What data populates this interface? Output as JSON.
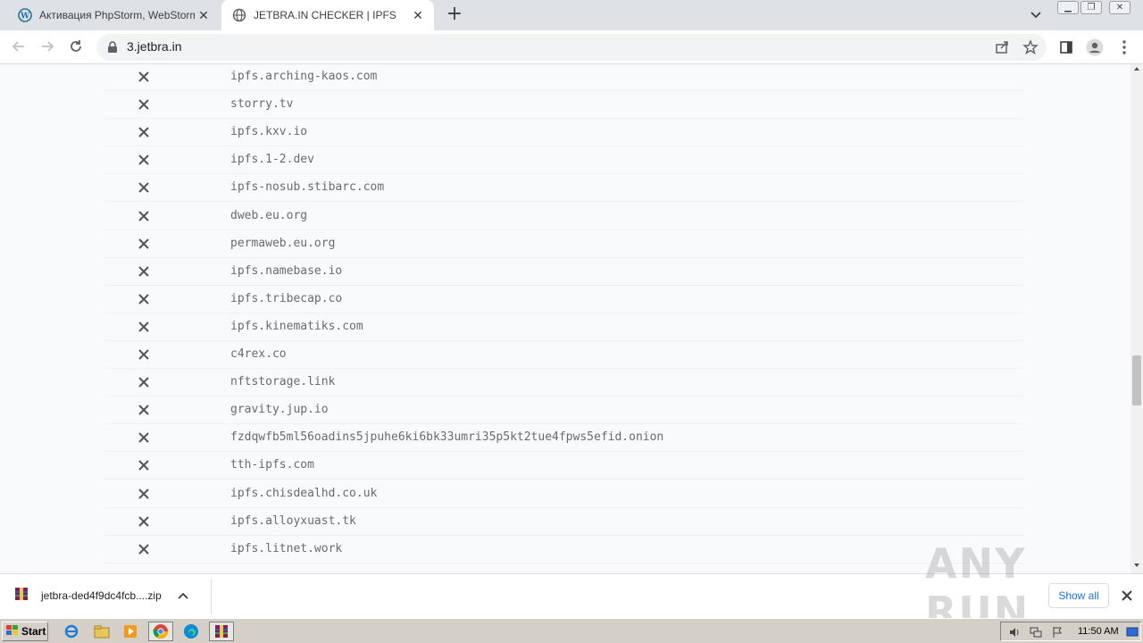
{
  "tabs": [
    {
      "title": "Активация PhpStorm, WebStorm, In",
      "active": false
    },
    {
      "title": "JETBRA.IN CHECKER | IPFS",
      "active": true
    }
  ],
  "address_bar": {
    "url": "3.jetbra.in"
  },
  "hosts": [
    "ipfs.arching-kaos.com",
    "storry.tv",
    "ipfs.kxv.io",
    "ipfs.1-2.dev",
    "ipfs-nosub.stibarc.com",
    "dweb.eu.org",
    "permaweb.eu.org",
    "ipfs.namebase.io",
    "ipfs.tribecap.co",
    "ipfs.kinematiks.com",
    "c4rex.co",
    "nftstorage.link",
    "gravity.jup.io",
    "fzdqwfb5ml56oadins5jpuhe6ki6bk33umri35p5kt2tue4fpws5efid.onion",
    "tth-ipfs.com",
    "ipfs.chisdealhd.co.uk",
    "ipfs.alloyxuast.tk",
    "ipfs.litnet.work"
  ],
  "download": {
    "filename": "jetbra-ded4f9dc4fcb....zip",
    "show_all": "Show all"
  },
  "watermark": "ANY RUN",
  "taskbar": {
    "start": "Start",
    "clock": "11:50 AM"
  },
  "colors": {
    "status_fail": "#555555",
    "accent": "#1a73e8"
  }
}
